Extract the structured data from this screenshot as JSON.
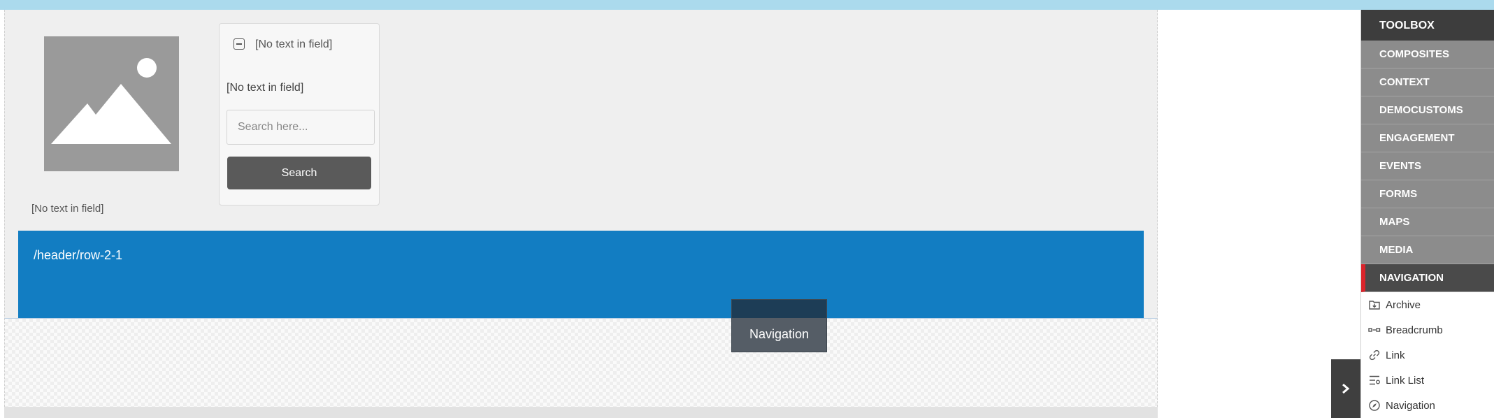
{
  "canvas": {
    "image_caption": "[No text in field]",
    "search_panel": {
      "title": "[No text in field]",
      "text": "[No text in field]",
      "search_placeholder": "Search here...",
      "search_button": "Search"
    },
    "row": {
      "path": "/header/row-2-1"
    },
    "drag_tooltip": {
      "label": "Navigation"
    }
  },
  "toolbox": {
    "title": "TOOLBOX",
    "categories": [
      {
        "label": "COMPOSITES"
      },
      {
        "label": "CONTEXT"
      },
      {
        "label": "DEMOCUSTOMS"
      },
      {
        "label": "ENGAGEMENT"
      },
      {
        "label": "EVENTS"
      },
      {
        "label": "FORMS"
      },
      {
        "label": "MAPS"
      },
      {
        "label": "MEDIA"
      },
      {
        "label": "NAVIGATION",
        "active": true
      }
    ],
    "items": [
      {
        "label": "Archive",
        "icon": "archive-icon"
      },
      {
        "label": "Breadcrumb",
        "icon": "breadcrumb-icon"
      },
      {
        "label": "Link",
        "icon": "link-icon"
      },
      {
        "label": "Link List",
        "icon": "link-list-icon"
      },
      {
        "label": "Navigation",
        "icon": "navigation-icon"
      }
    ]
  },
  "colors": {
    "top_bar": "#abdaed",
    "row_blue": "#127dc2",
    "active_accent": "#d9242b",
    "category_bg": "#8c8c8c",
    "header_bg": "#3d3d3d"
  }
}
